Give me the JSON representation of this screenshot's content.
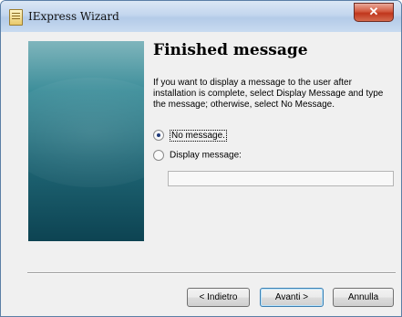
{
  "window": {
    "title": "IExpress Wizard",
    "close_glyph": "✕"
  },
  "page": {
    "heading": "Finished message",
    "description": "If you want to display a message to the user after installation is complete, select Display Message and type the message; otherwise, select No Message."
  },
  "options": {
    "no_message": {
      "label": "No message.",
      "checked": true
    },
    "display_message": {
      "label": "Display message:",
      "checked": false
    }
  },
  "message_input": {
    "value": ""
  },
  "buttons": {
    "back": "< Indietro",
    "next": "Avanti >",
    "cancel": "Annulla"
  },
  "icons": {
    "app": "iexpress-app-icon",
    "close": "close-icon"
  },
  "colors": {
    "side_panel_top": "#7fb5bc",
    "side_panel_bottom": "#0d4352",
    "close_button": "#c0361c"
  }
}
